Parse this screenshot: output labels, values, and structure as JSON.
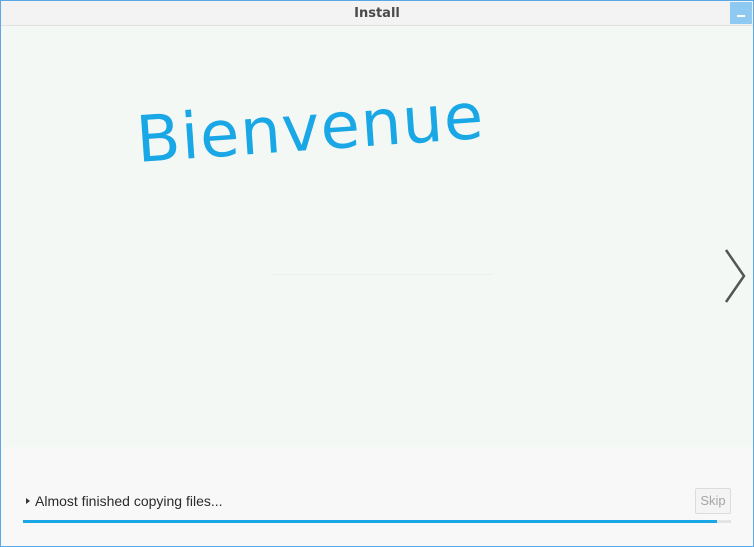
{
  "window": {
    "title": "Install"
  },
  "slideshow": {
    "welcome_text": "Bienvenue"
  },
  "progress": {
    "status_text": "Almost finished copying files...",
    "skip_label": "Skip",
    "fraction": 0.98
  },
  "colors": {
    "accent": "#1aa7e6",
    "titlebar_button": "#8ec9f2"
  },
  "icons": {
    "minimize": "minimize-icon",
    "next": "chevron-right-icon",
    "expander": "triangle-right-icon"
  }
}
